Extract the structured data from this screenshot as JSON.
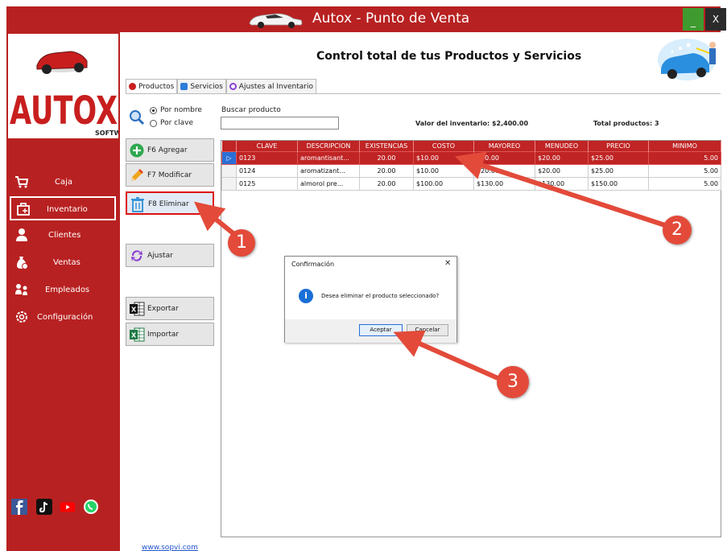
{
  "app": {
    "title": "Autox - Punto de Venta",
    "minimize": "_",
    "close": "X"
  },
  "sidebar": {
    "items": [
      {
        "label": "Caja"
      },
      {
        "label": "Inventario"
      },
      {
        "label": "Clientes"
      },
      {
        "label": "Ventas"
      },
      {
        "label": "Empleados"
      },
      {
        "label": "Configuración"
      }
    ],
    "link": "www.sopvi.com"
  },
  "header": {
    "title": "Control total de tus Productos y Servicios"
  },
  "tabs": [
    {
      "label": "Productos"
    },
    {
      "label": "Servicios"
    },
    {
      "label": "Ajustes al Inventario"
    }
  ],
  "search": {
    "radio_nombre": "Por nombre",
    "radio_clave": "Por clave",
    "label": "Buscar producto",
    "value": "",
    "valor": "Valor del inventario: $2,400.00",
    "total": "Total productos: 3"
  },
  "buttons": {
    "agregar": "F6 Agregar",
    "modificar": "F7 Modificar",
    "eliminar": "F8 Eliminar",
    "ajustar": "Ajustar",
    "exportar": "Exportar",
    "importar": "Importar"
  },
  "table": {
    "headers": [
      "CLAVE",
      "DESCRIPCION",
      "EXISTENCIAS",
      "COSTO",
      "MAYOREO",
      "MENUDEO",
      "PRECIO",
      "MINIMO"
    ],
    "rows": [
      [
        "0123",
        "aromantisant...",
        "20.00",
        "$10.00",
        "$20.00",
        "$20.00",
        "$25.00",
        "5.00"
      ],
      [
        "0124",
        "aromatizant...",
        "20.00",
        "$10.00",
        "$20.00",
        "$20.00",
        "$25.00",
        "5.00"
      ],
      [
        "0125",
        "almorol pre...",
        "20.00",
        "$100.00",
        "$130.00",
        "$130.00",
        "$150.00",
        "5.00"
      ]
    ]
  },
  "dialog": {
    "title": "Confirmación",
    "close": "✕",
    "icon": "info-icon",
    "message": "Desea eliminar el producto seleccionado?",
    "ok": "Aceptar",
    "cancel": "Cancelar"
  },
  "annotations": [
    "1",
    "2",
    "3"
  ],
  "colors": {
    "brand_red": "#b82121",
    "annotation_red": "#e34a3a",
    "min_green": "#3f9b2f"
  }
}
